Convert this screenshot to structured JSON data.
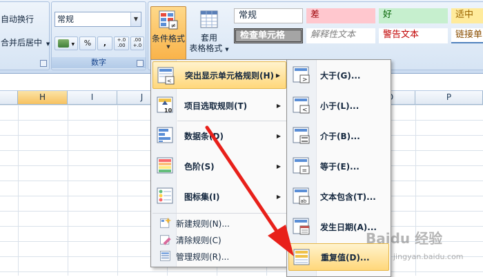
{
  "ribbon": {
    "alignment": {
      "wrap_text": "自动换行",
      "merge_center": "合并后居中"
    },
    "number": {
      "format_value": "常规",
      "currency": "$",
      "percent": "%",
      "comma": ",",
      "inc_decimal": "+.0\n.00",
      "dec_decimal": ".00\n+.0",
      "group_label": "数字"
    },
    "conditional_format": {
      "label": "条件格式"
    },
    "format_table": {
      "label_line1": "套用",
      "label_line2": "表格格式"
    },
    "styles": {
      "normal": "常规",
      "bad": "差",
      "good": "好",
      "neutral": "适中",
      "check_cell": "检查单元格",
      "explanatory": "解释性文本",
      "warning": "警告文本",
      "hyperlink": "链接单"
    }
  },
  "sheet": {
    "columns": [
      "H",
      "I",
      "J",
      "",
      "",
      "",
      "",
      "O",
      "P"
    ]
  },
  "menu_main": {
    "items": [
      {
        "label": "突出显示单元格规则(H)",
        "icon": "highlight-rules-icon",
        "submenu": true
      },
      {
        "label": "项目选取规则(T)",
        "icon": "top-bottom-rules-icon",
        "submenu": true
      },
      {
        "label": "数据条(D)",
        "icon": "data-bars-icon",
        "submenu": true
      },
      {
        "label": "色阶(S)",
        "icon": "color-scales-icon",
        "submenu": true
      },
      {
        "label": "图标集(I)",
        "icon": "icon-sets-icon",
        "submenu": true
      }
    ],
    "actions": [
      {
        "label": "新建规则(N)...",
        "icon": "new-rule-icon"
      },
      {
        "label": "清除规则(C)",
        "icon": "clear-rules-icon"
      },
      {
        "label": "管理规则(R)...",
        "icon": "manage-rules-icon"
      }
    ]
  },
  "menu_sub": {
    "items": [
      {
        "label": "大于(G)...",
        "icon": "greater-than-icon"
      },
      {
        "label": "小于(L)...",
        "icon": "less-than-icon"
      },
      {
        "label": "介于(B)...",
        "icon": "between-icon"
      },
      {
        "label": "等于(E)...",
        "icon": "equal-to-icon"
      },
      {
        "label": "文本包含(T)...",
        "icon": "text-contains-icon"
      },
      {
        "label": "发生日期(A)...",
        "icon": "date-occurring-icon"
      },
      {
        "label": "重复值(D)...",
        "icon": "duplicate-values-icon"
      }
    ]
  },
  "watermark": {
    "main": "Baidu 经验",
    "sub": "jingyan.baidu.com"
  },
  "colors": {
    "highlight": "#ffd77a",
    "arrow": "#e8201a",
    "ribbon_bg": "#dbe7f5",
    "bad_bg": "#ffc7ce",
    "good_bg": "#c6efce",
    "neutral_bg": "#ffeb9c"
  }
}
